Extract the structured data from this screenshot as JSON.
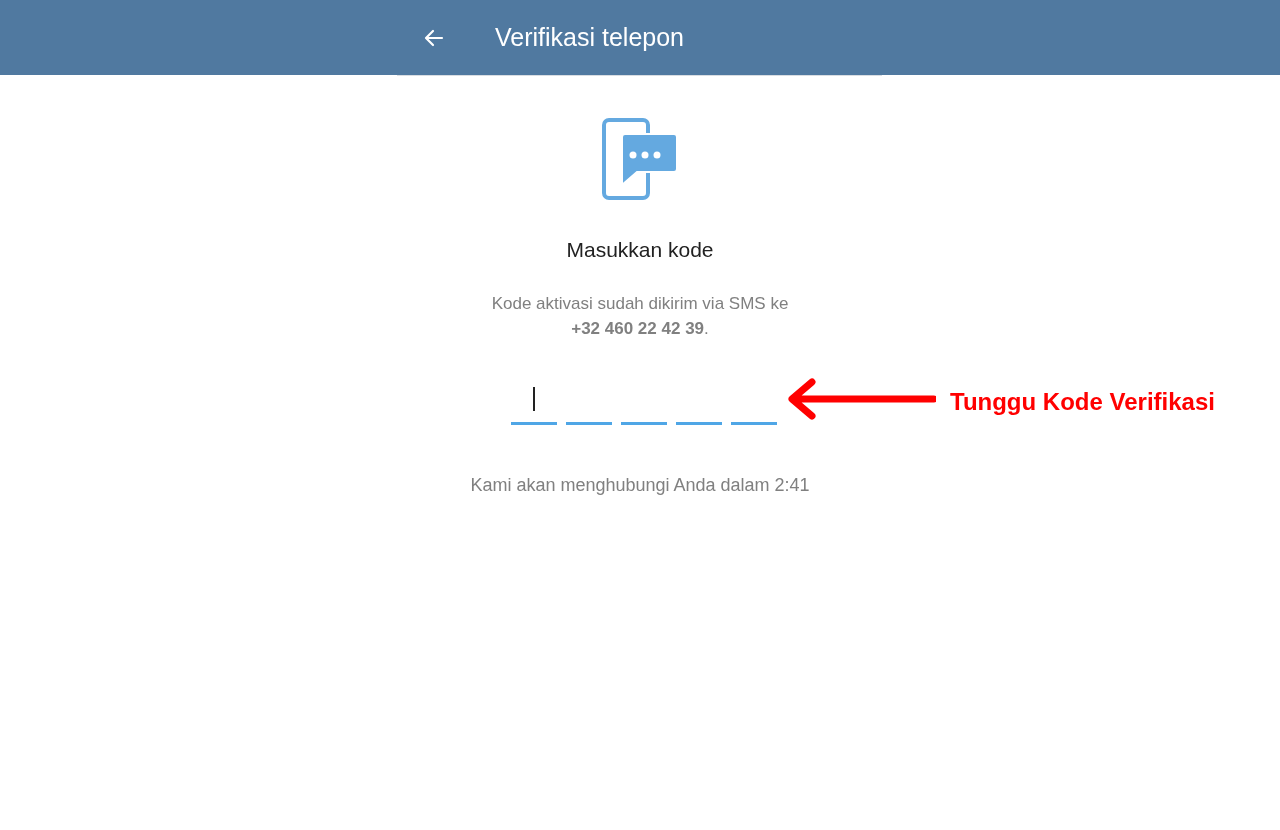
{
  "app_bar": {
    "title": "Verifikasi telepon"
  },
  "heading": "Masukkan kode",
  "description": "Kode aktivasi sudah dikirim via SMS ke\n**+32 460 22 42 39**.",
  "code_boxes": [
    {
      "focused": true
    },
    {
      "focused": false
    },
    {
      "focused": false
    },
    {
      "focused": false
    },
    {
      "focused": false
    }
  ],
  "timer": "Kami akan menghubungi Anda dalam 2:41",
  "annotation": {
    "text": "Tunggu Kode Verifikasi"
  }
}
